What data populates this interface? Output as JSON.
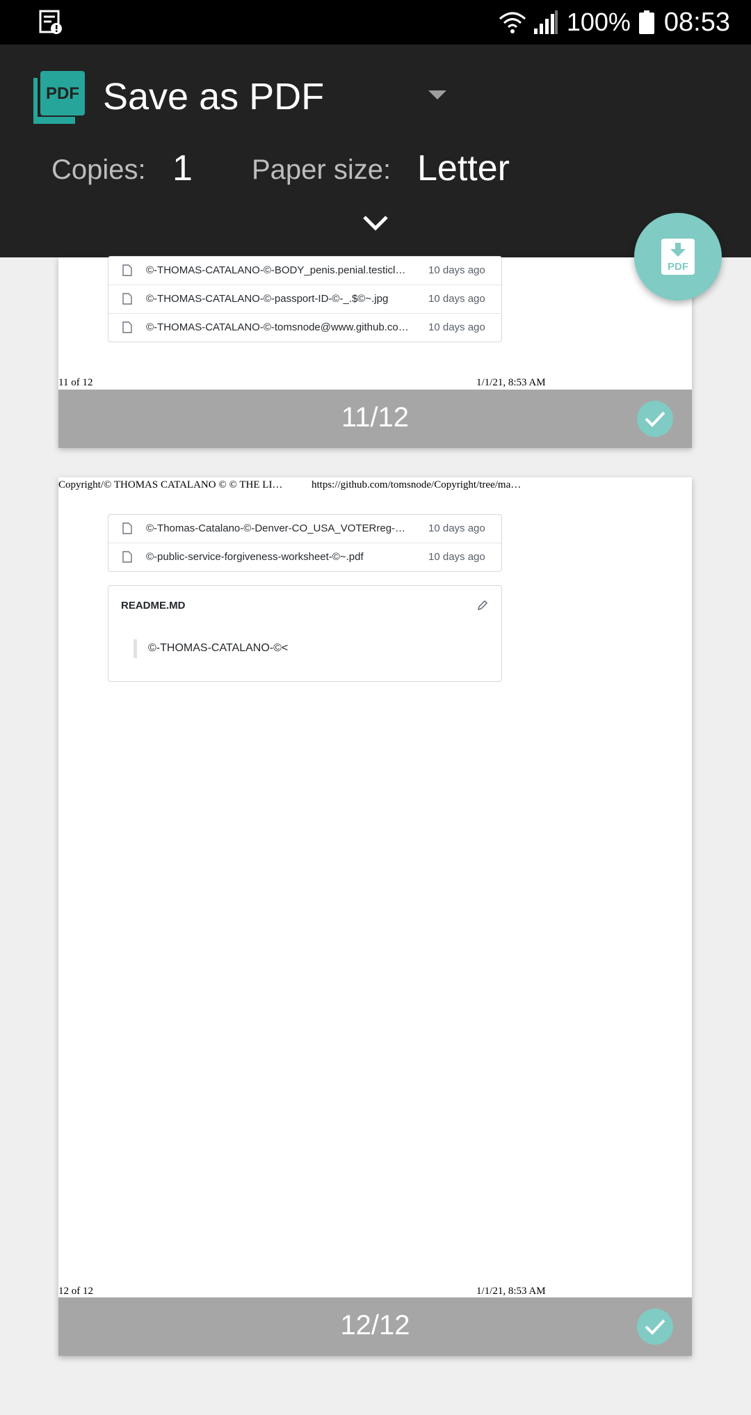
{
  "status_bar": {
    "battery_percent": "100%",
    "time": "08:53",
    "icons": [
      "notification-icon",
      "wifi-icon",
      "signal-icon",
      "battery-icon"
    ]
  },
  "print_header": {
    "printer_name": "Save as PDF",
    "copies_label": "Copies:",
    "copies_value": "1",
    "paper_size_label": "Paper size:",
    "paper_size_value": "Letter"
  },
  "pages": {
    "page11": {
      "files": [
        {
          "name": "©-THOMAS-CATALANO-©-BODY_penis.penial.testicle…",
          "time": "10 days ago"
        },
        {
          "name": "©-THOMAS-CATALANO-©-passport-ID-©-_.$©~.jpg",
          "time": "10 days ago"
        },
        {
          "name": "©-THOMAS-CATALANO-©-tomsnode@www.github.co…",
          "time": "10 days ago"
        }
      ],
      "footer_left": "11 of 12",
      "footer_right": "1/1/21, 8:53 AM",
      "page_label": "11/12"
    },
    "page12": {
      "header_left": "Copyright/© THOMAS CATALANO © © THE LI…",
      "header_right": "https://github.com/tomsnode/Copyright/tree/ma…",
      "files": [
        {
          "name": "©-Thomas-Catalano-©-Denver-CO_USA_VOTERreg-©-…",
          "time": "10 days ago"
        },
        {
          "name": "©-public-service-forgiveness-worksheet-©~.pdf",
          "time": "10 days ago"
        }
      ],
      "readme_title": "README.MD",
      "readme_quote": "©-THOMAS-CATALANO-©<",
      "footer_left": "12 of 12",
      "footer_right": "1/1/21, 8:53 AM",
      "page_label": "12/12"
    }
  },
  "colors": {
    "header_bg": "#222222",
    "accent": "#80cbc4",
    "page_bar": "#a6a6a6",
    "background": "#efefef"
  }
}
